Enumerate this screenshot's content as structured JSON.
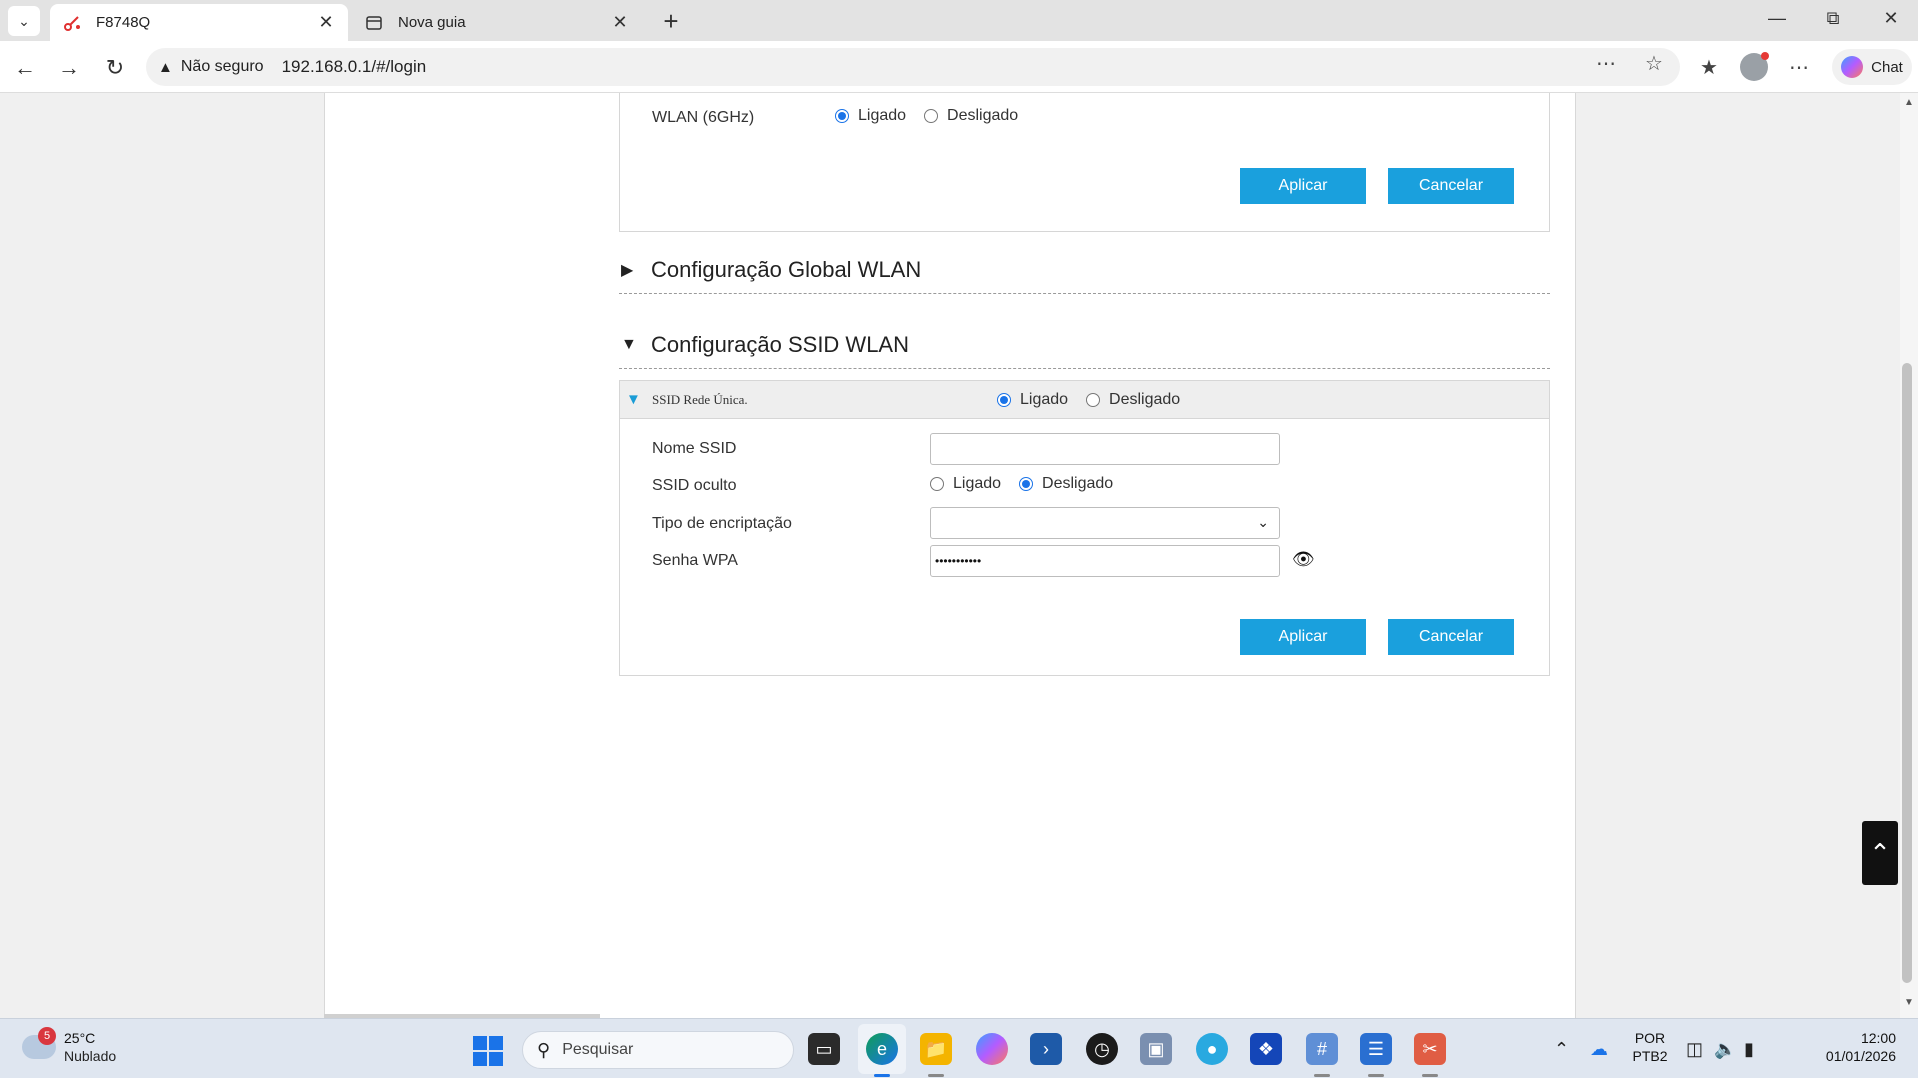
{
  "browser": {
    "tabs": [
      {
        "title": "F8748Q",
        "active": true
      },
      {
        "title": "Nova guia",
        "active": false
      }
    ],
    "security_label": "Não seguro",
    "url": "192.168.0.1/#/login",
    "chat_label": "Chat"
  },
  "wlan6": {
    "label": "WLAN (6GHz)",
    "on_label": "Ligado",
    "off_label": "Desligado",
    "selected": "Ligado",
    "apply_label": "Aplicar",
    "cancel_label": "Cancelar"
  },
  "sections": {
    "global_title": "Configuração Global WLAN",
    "ssid_title": "Configuração SSID WLAN"
  },
  "ssid": {
    "header_name": "SSID Rede Única.",
    "on_label": "Ligado",
    "off_label": "Desligado",
    "selected": "Ligado",
    "fields": {
      "name_label": "Nome SSID",
      "name_value": "",
      "hidden_label": "SSID oculto",
      "hidden_on": "Ligado",
      "hidden_off": "Desligado",
      "hidden_selected": "Desligado",
      "encryption_label": "Tipo de encriptação",
      "encryption_value": "",
      "password_label": "Senha WPA",
      "password_mask": "•••••••••••"
    },
    "apply_label": "Aplicar",
    "cancel_label": "Cancelar"
  },
  "taskbar": {
    "weather_badge": "5",
    "weather_temp": "25°C",
    "weather_cond": "Nublado",
    "search_placeholder": "Pesquisar",
    "lang_line1": "POR",
    "lang_line2": "PTB2",
    "time": "12:00",
    "date": "01/01/2026"
  },
  "colors": {
    "button_blue": "#1aa0dd",
    "radio_blue": "#1a73e8",
    "ssid_triangle": "#1a9cd6"
  }
}
